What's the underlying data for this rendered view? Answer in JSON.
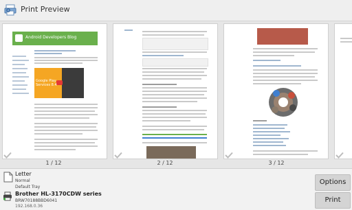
{
  "window": {
    "title": "Print Preview"
  },
  "pages": [
    {
      "label": "1 / 12",
      "blog_title": "Android Developers Blog",
      "video_text": "Google Play Services 8.4"
    },
    {
      "label": "2 / 12"
    },
    {
      "label": "3 / 12"
    }
  ],
  "settings": {
    "paper": "Letter",
    "quality": "Normal",
    "tray": "Default Tray"
  },
  "printer": {
    "name": "Brother HL-3170CDW series",
    "id": "BRW70188BBD6041",
    "ip": "192.168.0.36"
  },
  "buttons": {
    "options": "Options",
    "print": "Print"
  },
  "colors": {
    "blog_header": "#6ab04c",
    "video_orange": "#f5a623",
    "accent_blue": "#3f7fd0"
  }
}
